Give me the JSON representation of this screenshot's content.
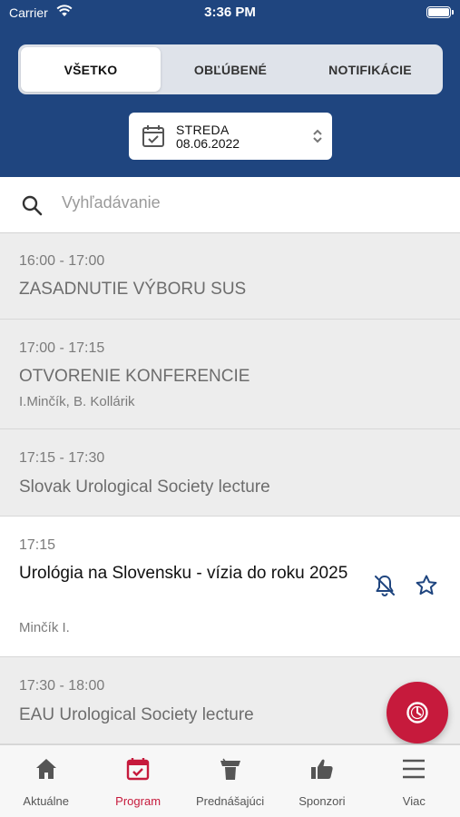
{
  "status": {
    "carrier": "Carrier",
    "time": "3:36 PM"
  },
  "segments": {
    "all": "VŠETKO",
    "favorites": "OBĽÚBENÉ",
    "notifications": "NOTIFIKÁCIE",
    "selected": "VŠETKO"
  },
  "date": {
    "day": "STREDA",
    "value": "08.06.2022"
  },
  "search": {
    "placeholder": "Vyhľadávanie"
  },
  "events": [
    {
      "time": "16:00 - 17:00",
      "title": "ZASADNUTIE VÝBORU SUS"
    },
    {
      "time": "17:00 - 17:15",
      "title": "OTVORENIE KONFERENCIE",
      "speakers": "I.Minčík, B. Kollárik"
    },
    {
      "time": "17:15 - 17:30",
      "title": "Slovak Urological Society lecture"
    },
    {
      "time": "17:15",
      "title": "Urológia na Slovensku - vízia do roku 2025",
      "speakers": "Minčík I."
    },
    {
      "time": "17:30 - 18:00",
      "title": "EAU Urological Society lecture"
    }
  ],
  "tabs": [
    {
      "label": "Aktuálne",
      "icon": "home-icon"
    },
    {
      "label": "Program",
      "icon": "calendar-check-icon",
      "active": true
    },
    {
      "label": "Prednášajúci",
      "icon": "podium-icon"
    },
    {
      "label": "Sponzori",
      "icon": "thumbs-up-icon"
    },
    {
      "label": "Viac",
      "icon": "menu-icon"
    }
  ],
  "colors": {
    "header": "#1f457f",
    "accent": "#c61a3c",
    "icon_blue": "#1f457f"
  }
}
